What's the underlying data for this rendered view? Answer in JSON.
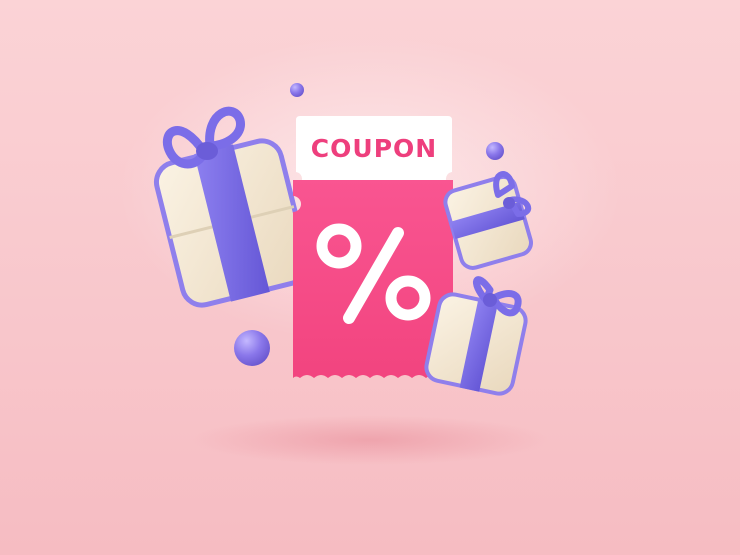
{
  "coupon": {
    "label": "COUPON",
    "symbol": "%"
  },
  "colors": {
    "background": "#f9cdd1",
    "coupon_pink": "#f54d88",
    "coupon_header": "#ffffff",
    "label_text": "#ee3f7d",
    "ribbon_purple": "#7a6de8",
    "gift_box": "#f5e8d3",
    "sphere_purple": "#8b78e8"
  },
  "icons": [
    "gift-box-icon",
    "coupon-ticket-icon",
    "percent-icon",
    "sphere-icon"
  ]
}
